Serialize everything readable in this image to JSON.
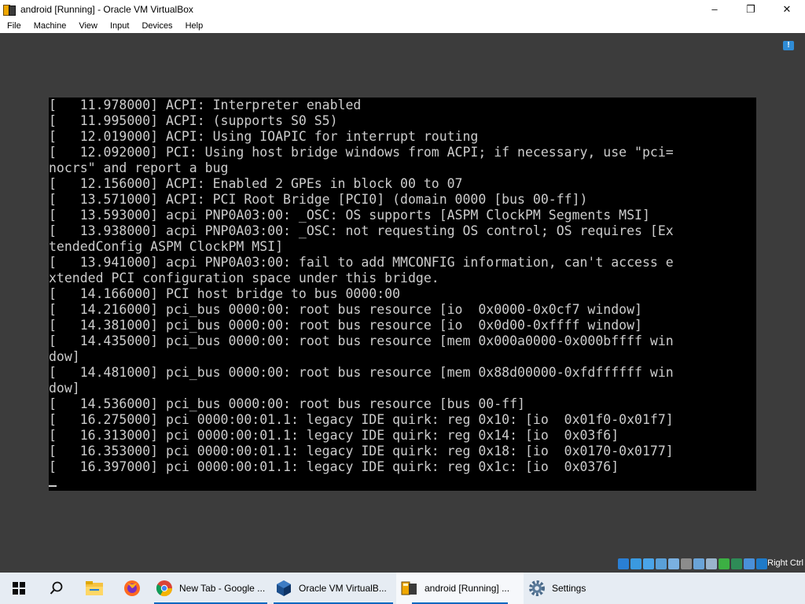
{
  "window": {
    "title": "android [Running] - Oracle VM VirtualBox",
    "controls": [
      "–",
      "❐",
      "✕"
    ]
  },
  "menubar": {
    "items": [
      "File",
      "Machine",
      "View",
      "Input",
      "Devices",
      "Help"
    ]
  },
  "console": {
    "lines": [
      "[   11.978000] ACPI: Interpreter enabled",
      "[   11.995000] ACPI: (supports S0 S5)",
      "[   12.019000] ACPI: Using IOAPIC for interrupt routing",
      "[   12.092000] PCI: Using host bridge windows from ACPI; if necessary, use \"pci=",
      "nocrs\" and report a bug",
      "[   12.156000] ACPI: Enabled 2 GPEs in block 00 to 07",
      "[   13.571000] ACPI: PCI Root Bridge [PCI0] (domain 0000 [bus 00-ff])",
      "[   13.593000] acpi PNP0A03:00: _OSC: OS supports [ASPM ClockPM Segments MSI]",
      "[   13.938000] acpi PNP0A03:00: _OSC: not requesting OS control; OS requires [Ex",
      "tendedConfig ASPM ClockPM MSI]",
      "[   13.941000] acpi PNP0A03:00: fail to add MMCONFIG information, can't access e",
      "xtended PCI configuration space under this bridge.",
      "[   14.166000] PCI host bridge to bus 0000:00",
      "[   14.216000] pci_bus 0000:00: root bus resource [io  0x0000-0x0cf7 window]",
      "[   14.381000] pci_bus 0000:00: root bus resource [io  0x0d00-0xffff window]",
      "[   14.435000] pci_bus 0000:00: root bus resource [mem 0x000a0000-0x000bffff win",
      "dow]",
      "[   14.481000] pci_bus 0000:00: root bus resource [mem 0x88d00000-0xfdffffff win",
      "dow]",
      "[   14.536000] pci_bus 0000:00: root bus resource [bus 00-ff]",
      "[   16.275000] pci 0000:00:01.1: legacy IDE quirk: reg 0x10: [io  0x01f0-0x01f7]",
      "[   16.313000] pci 0000:00:01.1: legacy IDE quirk: reg 0x14: [io  0x03f6]",
      "[   16.353000] pci 0000:00:01.1: legacy IDE quirk: reg 0x18: [io  0x0170-0x0177]",
      "[   16.397000] pci 0000:00:01.1: legacy IDE quirk: reg 0x1c: [io  0x0376]"
    ]
  },
  "statusbar": {
    "host_key": "Right Ctrl",
    "icon_names": [
      "hard-disk-icon",
      "optical-drive-icon",
      "audio-icon",
      "network-icon",
      "usb-icon",
      "shared-folders-icon",
      "display-icon",
      "video-capture-icon",
      "recording-icon",
      "cpu-icon",
      "mouse-integration-icon",
      "keyboard-icon"
    ],
    "icon_colors": [
      "#2a7fd4",
      "#3a9ae0",
      "#4aa4e8",
      "#5aa0d8",
      "#7ab0e0",
      "#8c8c8c",
      "#6aa4d8",
      "#9ab4cc",
      "#3cb043",
      "#2e8b57",
      "#4a90d9",
      "#1e7ac8"
    ]
  },
  "taskbar": {
    "start_icon": "windows-start-icon",
    "search_icon": "search-icon",
    "pinned": [
      {
        "name": "file-explorer-icon",
        "color": "#f5c242"
      },
      {
        "name": "firefox-icon",
        "color": "#ff6a1f"
      }
    ],
    "apps": [
      {
        "label": "New Tab - Google ...",
        "icon": "chrome-icon",
        "color": "#db4437"
      },
      {
        "label": "Oracle VM VirtualB...",
        "icon": "virtualbox-icon",
        "color": "#1c4f8c"
      },
      {
        "label": "android [Running] ...",
        "icon": "vm-running-icon",
        "color": "#f0a800"
      },
      {
        "label": "Settings",
        "icon": "settings-icon",
        "color": "#5a5a5a"
      }
    ]
  },
  "colors": {
    "console_bg": "#000000",
    "console_text": "#cccccc",
    "vm_bg": "#3c3c3c",
    "taskbar_bg": "#e6ecf3",
    "accent": "#0067c0"
  }
}
